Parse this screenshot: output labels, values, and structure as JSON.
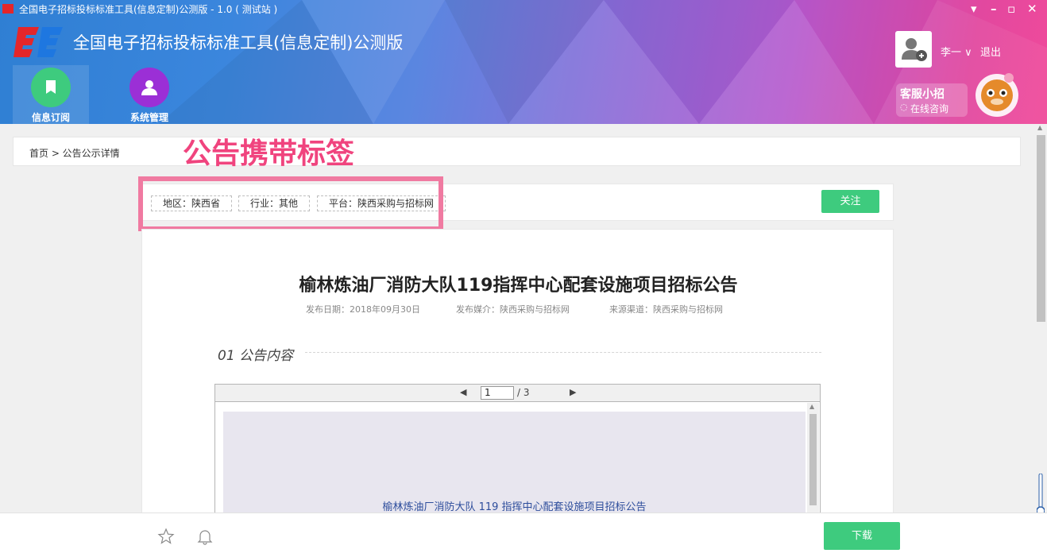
{
  "window": {
    "title": "全国电子招标投标标准工具(信息定制)公测版 - 1.0 ( 测试站 )",
    "controls": [
      "menu-icon",
      "minimize-icon",
      "restore-icon",
      "close-icon"
    ]
  },
  "header": {
    "app_title": "全国电子招标投标标准工具(信息定制)公测版",
    "nav": [
      {
        "label": "信息订阅",
        "icon": "bookmark-icon",
        "color": "#3ecb7e",
        "active": true
      },
      {
        "label": "系统管理",
        "icon": "user-icon",
        "color": "#9b2fd6",
        "active": false
      }
    ],
    "user": {
      "name": "李一",
      "logout": "退出"
    },
    "customer_service": {
      "title": "客服小招",
      "subtitle": "在线咨询"
    }
  },
  "breadcrumb": "首页 > 公告公示详情",
  "callout": "公告携带标签",
  "tags": [
    "地区：陕西省",
    "行业：其他",
    "平台：陕西采购与招标网"
  ],
  "follow_label": "关注",
  "document": {
    "title": "榆林炼油厂消防大队119指挥中心配套设施项目招标公告",
    "publish_date": "发布日期：2018年09月30日",
    "publish_media": "发布媒介：陕西采购与招标网",
    "source": "来源渠道：陕西采购与招标网",
    "section": "01 公告内容"
  },
  "viewer": {
    "current_page": "1",
    "total_pages": "/ 3",
    "page_heading": "榆林炼油厂消防大队 119 指挥中心配套设施项目招标公告"
  },
  "footer": {
    "download_label": "下载"
  },
  "colors": {
    "accent_green": "#3ecb7e",
    "callout_pink": "#f0447e",
    "highlight_border": "#f07aa1"
  }
}
